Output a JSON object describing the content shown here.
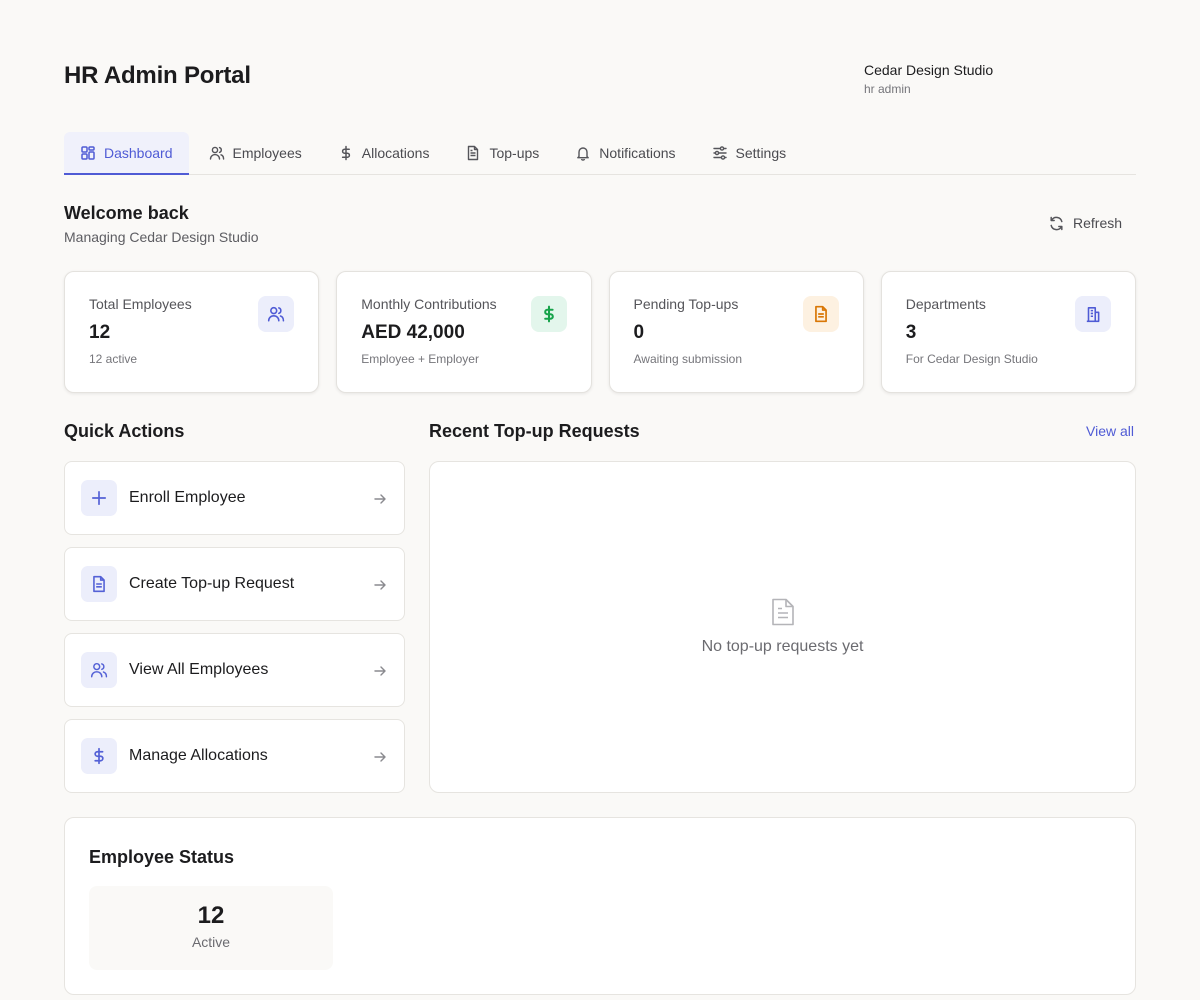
{
  "header": {
    "app_title": "HR Admin Portal",
    "org_name": "Cedar Design Studio",
    "user_role": "hr admin"
  },
  "tabs": [
    {
      "label": "Dashboard",
      "icon": "dashboard-icon",
      "active": true
    },
    {
      "label": "Employees",
      "icon": "users-icon",
      "active": false
    },
    {
      "label": "Allocations",
      "icon": "dollar-icon",
      "active": false
    },
    {
      "label": "Top-ups",
      "icon": "document-icon",
      "active": false
    },
    {
      "label": "Notifications",
      "icon": "bell-icon",
      "active": false
    },
    {
      "label": "Settings",
      "icon": "sliders-icon",
      "active": false
    }
  ],
  "welcome": {
    "title": "Welcome back",
    "subtitle": "Managing Cedar Design Studio",
    "refresh_label": "Refresh"
  },
  "stats": [
    {
      "label": "Total Employees",
      "value": "12",
      "note": "12 active",
      "icon": "users-icon",
      "icon_bg": "#eceefb",
      "icon_color": "#4f5bd5"
    },
    {
      "label": "Monthly Contributions",
      "value": "AED 42,000",
      "note": "Employee + Employer",
      "icon": "dollar-icon",
      "icon_bg": "#e3f6ec",
      "icon_color": "#16a34a"
    },
    {
      "label": "Pending Top-ups",
      "value": "0",
      "note": "Awaiting submission",
      "icon": "document-icon",
      "icon_bg": "#fdf1e1",
      "icon_color": "#d97706"
    },
    {
      "label": "Departments",
      "value": "3",
      "note": "For Cedar Design Studio",
      "icon": "building-icon",
      "icon_bg": "#eceefb",
      "icon_color": "#4f5bd5"
    }
  ],
  "quick_actions": {
    "title": "Quick Actions",
    "items": [
      {
        "label": "Enroll Employee",
        "icon": "plus-icon"
      },
      {
        "label": "Create Top-up Request",
        "icon": "document-icon"
      },
      {
        "label": "View All Employees",
        "icon": "users-icon"
      },
      {
        "label": "Manage Allocations",
        "icon": "dollar-icon"
      }
    ]
  },
  "recent_topups": {
    "title": "Recent Top-up Requests",
    "view_all_label": "View all",
    "empty_text": "No top-up requests yet"
  },
  "employee_status": {
    "title": "Employee Status",
    "count": "12",
    "label": "Active"
  },
  "colors": {
    "accent": "#4f5bd5",
    "background": "#faf9f7"
  }
}
